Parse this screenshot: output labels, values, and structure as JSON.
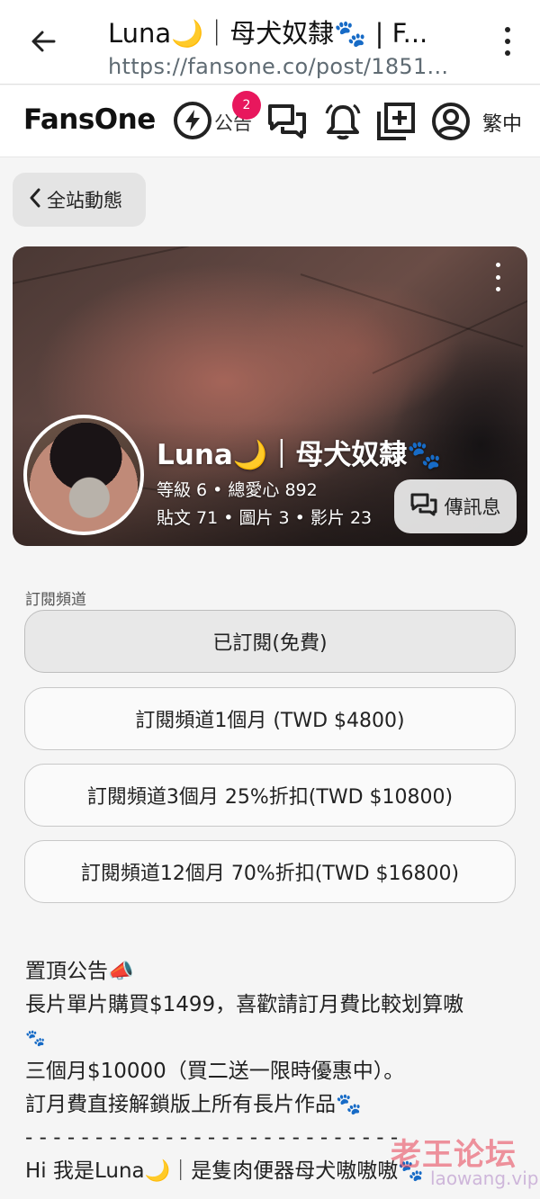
{
  "browser": {
    "tab_title": "Luna🌙｜母犬奴隸🐾 | F...",
    "url": "https://fansone.co/post/1851..."
  },
  "site_nav": {
    "logo": "FansOne",
    "announcement_label": "公告",
    "announcement_badge": "2",
    "language": "繁中",
    "icons": [
      "bolt-icon",
      "messages-icon",
      "bell-icon",
      "add-post-icon",
      "profile-icon"
    ]
  },
  "breadcrumb": {
    "label": "全站動態"
  },
  "creator": {
    "name": "Luna🌙｜母犬奴隸🐾",
    "stats_line1": "等級 6 • 總愛心 892",
    "stats_line2": "貼文 71 • 圖片 3 • 影片 23",
    "message_button": "傳訊息"
  },
  "subscription": {
    "section_label": "訂閱頻道",
    "options": [
      {
        "label": "已訂閱(免費)",
        "active": true
      },
      {
        "label": "訂閱頻道1個月 (TWD $4800)",
        "active": false
      },
      {
        "label": "訂閱頻道3個月 25%折扣(TWD $10800)",
        "active": false
      },
      {
        "label": "訂閱頻道12個月 70%折扣(TWD $16800)",
        "active": false
      }
    ]
  },
  "pinned_notice": {
    "lines": [
      "置頂公告📣",
      "長片單片購買$1499，喜歡請訂月費比較划算嗷",
      "🐾",
      "三個月$10000（買二送一限時優惠中）。",
      "訂月費直接解鎖版上所有長片作品🐾",
      "- - - - - - - - - - - - - - - - - - - - - - - - - - -",
      "Hi 我是Luna🌙｜是隻肉便器母犬嗷嗷嗷🐾"
    ]
  },
  "watermark": {
    "title": "老王论坛",
    "domain": "laowang.vip"
  }
}
